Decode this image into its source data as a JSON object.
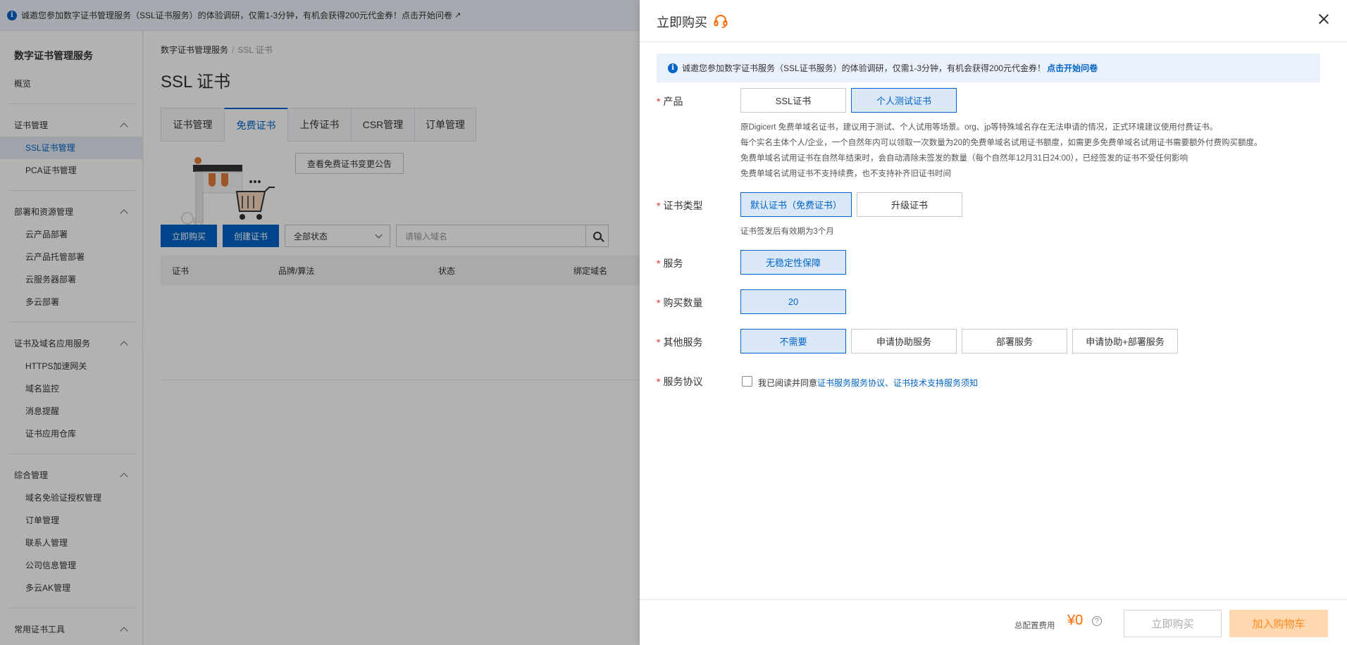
{
  "banner": {
    "text": "诚邀您参加数字证书管理服务（SSL证书服务）的体验调研，仅需1-3分钟，有机会获得200元代金券！点击开始问卷"
  },
  "sidebar": {
    "title": "数字证书管理服务",
    "overview": "概览",
    "groups": [
      {
        "label": "证书管理",
        "items": [
          "SSL证书管理",
          "PCA证书管理"
        ]
      },
      {
        "label": "部署和资源管理",
        "items": [
          "云产品部署",
          "云产品托管部署",
          "云服务器部署",
          "多云部署"
        ]
      },
      {
        "label": "证书及域名应用服务",
        "items": [
          "HTTPS加速网关",
          "域名监控",
          "消息提醒",
          "证书应用仓库"
        ]
      },
      {
        "label": "综合管理",
        "items": [
          "域名免验证授权管理",
          "订单管理",
          "联系人管理",
          "公司信息管理",
          "多云AK管理"
        ]
      },
      {
        "label": "常用证书工具",
        "items": []
      }
    ],
    "active_item": "SSL证书管理"
  },
  "main": {
    "breadcrumb": [
      "数字证书管理服务",
      "SSL 证书"
    ],
    "page_title": "SSL 证书",
    "tabs": [
      "证书管理",
      "免费证书",
      "上传证书",
      "CSR管理",
      "订单管理"
    ],
    "active_tab": "免费证书",
    "notice_button": "查看免费证书变更公告",
    "toolbar": {
      "buy_button": "立即购买",
      "create_button": "创建证书",
      "status_select": "全部状态",
      "search_placeholder": "请输入域名"
    },
    "table_columns": [
      "证书",
      "品牌/算法",
      "状态",
      "绑定域名"
    ]
  },
  "drawer": {
    "title": "立即购买",
    "alert_text": "诚邀您参加数字证书服务（SSL证书服务）的体验调研，仅需1-3分钟，有机会获得200元代金券！",
    "alert_link": "点击开始问卷",
    "product": {
      "label": "产品",
      "options": [
        "SSL证书",
        "个人测试证书"
      ],
      "selected": "个人测试证书",
      "desc": [
        "原Digicert 免费单域名证书，建议用于测试、个人试用等场景。org、jp等特殊域名存在无法申请的情况，正式环境建议使用付费证书。",
        "每个实名主体个人/企业，一个自然年内可以领取一次数量为20的免费单域名试用证书额度，如需更多免费单域名试用证书需要额外付费购买额度。",
        "免费单域名试用证书在自然年结束时，会自动清除未签发的数量（每个自然年12月31日24:00），已经签发的证书不受任何影响",
        "免费单域名试用证书不支持续费，也不支持补齐旧证书时间"
      ]
    },
    "cert_type": {
      "label": "证书类型",
      "options": [
        "默认证书（免费证书）",
        "升级证书"
      ],
      "selected": "默认证书（免费证书）",
      "desc": "证书签发后有效期为3个月"
    },
    "service": {
      "label": "服务",
      "options": [
        "无稳定性保障"
      ],
      "selected": "无稳定性保障"
    },
    "quantity": {
      "label": "购买数量",
      "value": "20"
    },
    "other_service": {
      "label": "其他服务",
      "options": [
        "不需要",
        "申请协助服务",
        "部署服务",
        "申请协助+部署服务"
      ],
      "selected": "不需要"
    },
    "agreement": {
      "label": "服务协议",
      "prefix": "我已阅读并同意",
      "link": "证书服务服务协议、证书技术支持服务须知",
      "checked": false
    },
    "footer": {
      "fee_label": "总配置费用",
      "fee_value": "¥0",
      "buy_button": "立即购买",
      "cart_button": "加入购物车"
    }
  },
  "colors": {
    "primary": "#0064c8",
    "selected_bg": "#d9e7f7",
    "required": "#d93026",
    "price": "#ff6a00",
    "cart_bg": "#ffd8b0"
  }
}
